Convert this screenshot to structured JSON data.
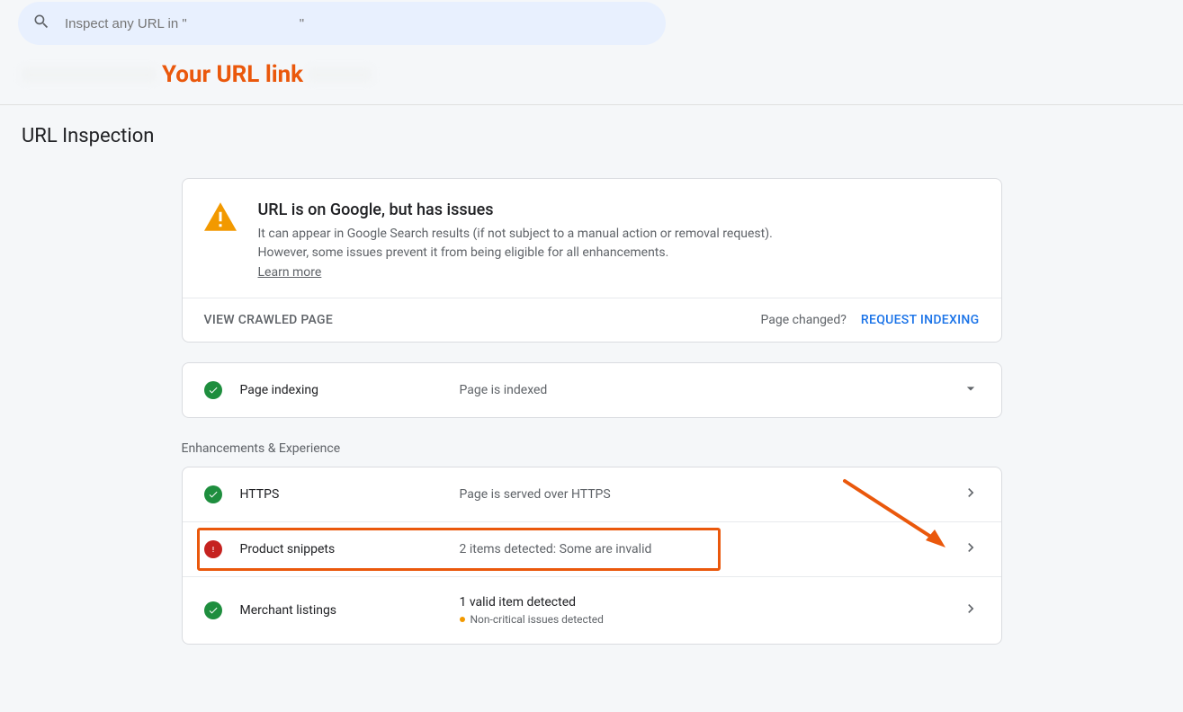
{
  "search": {
    "placeholder": "Inspect any URL in \"                              \""
  },
  "url_link_annotation": "Your URL link",
  "page_title": "URL Inspection",
  "status_card": {
    "title": "URL is on Google, but has issues",
    "description": "It can appear in Google Search results (if not subject to a manual action or removal request). However, some issues prevent it from being eligible for all enhancements.",
    "learn_more": "Learn more",
    "view_crawled": "VIEW CRAWLED PAGE",
    "page_changed": "Page changed?",
    "request_indexing": "REQUEST INDEXING"
  },
  "indexing_row": {
    "label": "Page indexing",
    "value": "Page is indexed"
  },
  "enhancements_heading": "Enhancements & Experience",
  "enhancements": {
    "https": {
      "label": "HTTPS",
      "value": "Page is served over HTTPS"
    },
    "product_snippets": {
      "label": "Product snippets",
      "value": "2 items detected: Some are invalid"
    },
    "merchant": {
      "label": "Merchant listings",
      "value": "1 valid item detected",
      "sub": "Non-critical issues detected"
    }
  }
}
